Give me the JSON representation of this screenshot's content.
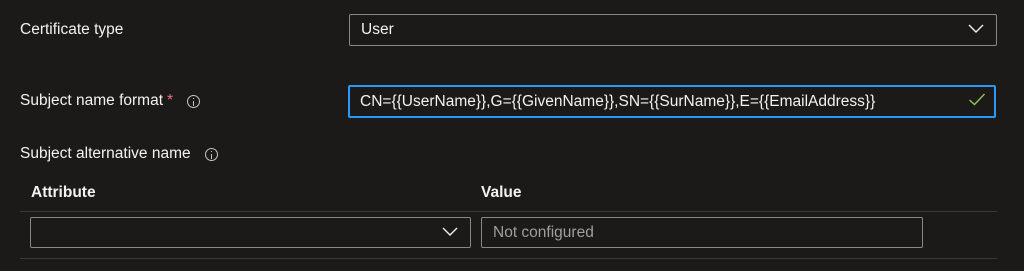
{
  "certificate_type": {
    "label": "Certificate type",
    "value": "User"
  },
  "subject_name_format": {
    "label": "Subject name format",
    "required_marker": "*",
    "value": "CN={{UserName}},G={{GivenName}},SN={{SurName}},E={{EmailAddress}}"
  },
  "subject_alternative_name": {
    "label": "Subject alternative name",
    "columns": {
      "attribute": "Attribute",
      "value": "Value"
    },
    "row": {
      "attribute_value": "",
      "value_placeholder": "Not configured"
    }
  },
  "colors": {
    "accent": "#2899f5",
    "required": "#f1707b",
    "valid": "#92c353"
  }
}
